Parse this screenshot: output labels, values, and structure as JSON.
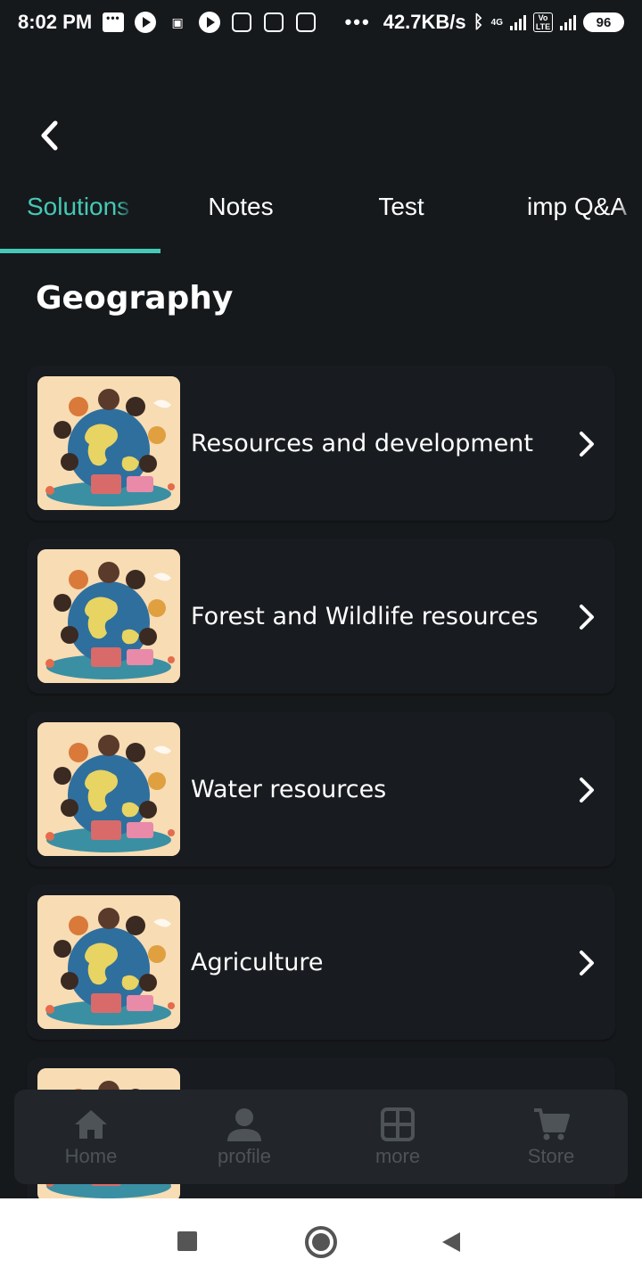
{
  "status_bar": {
    "time": "8:02 PM",
    "dots": "•••",
    "network_speed": "42.7KB/s",
    "network_type_1": "4G",
    "network_type_2": "Vo LTE",
    "battery": "96"
  },
  "header": {
    "back_icon": "chevron-left-icon"
  },
  "tabs": [
    {
      "label": "Solutions",
      "active": true
    },
    {
      "label": "Notes",
      "active": false
    },
    {
      "label": "Test",
      "active": false
    },
    {
      "label": "imp Q&A",
      "active": false
    }
  ],
  "section_title": "Geography",
  "chapters": [
    {
      "title": "Resources and development"
    },
    {
      "title": "Forest and Wildlife resources"
    },
    {
      "title": "Water resources"
    },
    {
      "title": "Agriculture"
    },
    {
      "title": ""
    }
  ],
  "bottom_nav": [
    {
      "label": "Home",
      "icon": "home-icon"
    },
    {
      "label": "profile",
      "icon": "person-icon"
    },
    {
      "label": "more",
      "icon": "grid-icon"
    },
    {
      "label": "Store",
      "icon": "cart-icon"
    }
  ],
  "colors": {
    "background": "#16191c",
    "accent": "#45c9b6",
    "card": "#181b1f",
    "nav_bg": "#22262a",
    "nav_text": "#4e5358"
  }
}
